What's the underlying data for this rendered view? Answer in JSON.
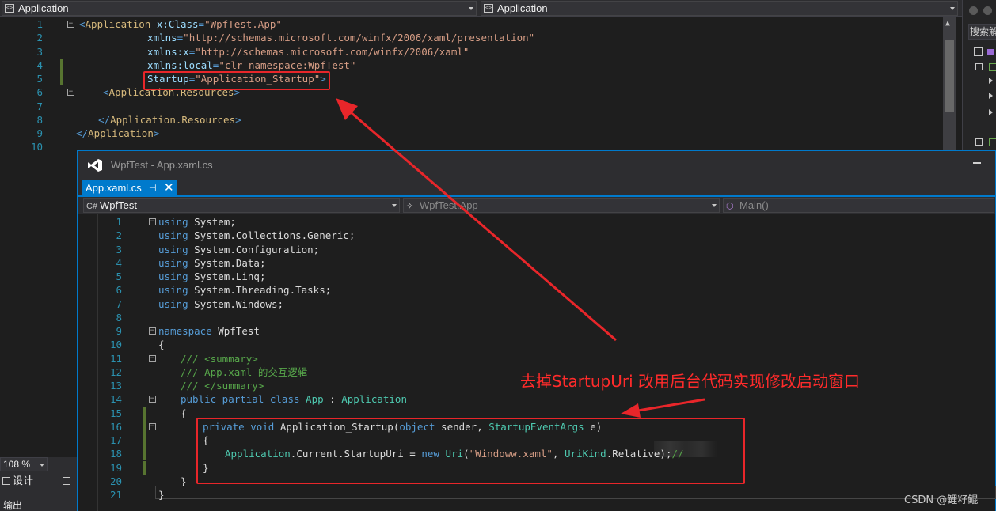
{
  "top_nav": {
    "left_scope": "Application",
    "right_scope": "Application"
  },
  "side_panel": {
    "search_placeholder": "搜索解"
  },
  "xaml_editor": {
    "lines": [
      {
        "n": "1",
        "tokens": [
          [
            "t-tag",
            "<"
          ],
          [
            "t-el",
            "Application"
          ],
          [
            "t-plain",
            " "
          ],
          [
            "t-attr",
            "x:Class"
          ],
          [
            "t-tag",
            "="
          ],
          [
            "t-str",
            "\"WpfTest.App\""
          ]
        ]
      },
      {
        "n": "2",
        "tokens": [
          [
            "t-attr",
            "xmlns"
          ],
          [
            "t-tag",
            "="
          ],
          [
            "t-str",
            "\"http://schemas.microsoft.com/winfx/2006/xaml/presentation\""
          ]
        ]
      },
      {
        "n": "3",
        "tokens": [
          [
            "t-attr",
            "xmlns:x"
          ],
          [
            "t-tag",
            "="
          ],
          [
            "t-str",
            "\"http://schemas.microsoft.com/winfx/2006/xaml\""
          ]
        ]
      },
      {
        "n": "4",
        "tokens": [
          [
            "t-attr",
            "xmlns:local"
          ],
          [
            "t-tag",
            "="
          ],
          [
            "t-str",
            "\"clr-namespace:WpfTest\""
          ]
        ]
      },
      {
        "n": "5",
        "tokens": [
          [
            "t-attr",
            "Startup"
          ],
          [
            "t-tag",
            "="
          ],
          [
            "t-str",
            "\"Application_Startup\""
          ],
          [
            "t-tag",
            ">"
          ]
        ]
      },
      {
        "n": "6",
        "tokens": [
          [
            "t-tag",
            "<"
          ],
          [
            "t-el",
            "Application.Resources"
          ],
          [
            "t-tag",
            ">"
          ]
        ]
      },
      {
        "n": "7",
        "tokens": []
      },
      {
        "n": "8",
        "tokens": [
          [
            "t-tag",
            "</"
          ],
          [
            "t-el",
            "Application.Resources"
          ],
          [
            "t-tag",
            ">"
          ]
        ]
      },
      {
        "n": "9",
        "tokens": [
          [
            "t-tag",
            "</"
          ],
          [
            "t-el",
            "Application"
          ],
          [
            "t-tag",
            ">"
          ]
        ]
      },
      {
        "n": "10",
        "tokens": []
      }
    ]
  },
  "status": {
    "zoom": "108 %",
    "design_tab": "设计",
    "output_label": "输出"
  },
  "window": {
    "title": "WpfTest - App.xaml.cs",
    "tab_label": "App.xaml.cs",
    "pin_glyph": "⊣",
    "close_glyph": "✕"
  },
  "nav2": {
    "project": "WpfTest",
    "class": "WpfTest.App",
    "member": "Main()"
  },
  "cs_editor": {
    "lines": [
      {
        "n": "1",
        "tokens": [
          [
            "t-kw",
            "using"
          ],
          [
            "t-plain",
            " System;"
          ]
        ]
      },
      {
        "n": "2",
        "tokens": [
          [
            "t-kw",
            "using"
          ],
          [
            "t-plain",
            " System.Collections.Generic;"
          ]
        ]
      },
      {
        "n": "3",
        "tokens": [
          [
            "t-kw",
            "using"
          ],
          [
            "t-plain",
            " System.Configuration;"
          ]
        ]
      },
      {
        "n": "4",
        "tokens": [
          [
            "t-kw",
            "using"
          ],
          [
            "t-plain",
            " System.Data;"
          ]
        ]
      },
      {
        "n": "5",
        "tokens": [
          [
            "t-kw",
            "using"
          ],
          [
            "t-plain",
            " System.Linq;"
          ]
        ]
      },
      {
        "n": "6",
        "tokens": [
          [
            "t-kw",
            "using"
          ],
          [
            "t-plain",
            " System.Threading.Tasks;"
          ]
        ]
      },
      {
        "n": "7",
        "tokens": [
          [
            "t-kw",
            "using"
          ],
          [
            "t-plain",
            " System.Windows;"
          ]
        ]
      },
      {
        "n": "8",
        "tokens": []
      },
      {
        "n": "9",
        "tokens": [
          [
            "t-kw",
            "namespace"
          ],
          [
            "t-plain",
            " WpfTest"
          ]
        ]
      },
      {
        "n": "10",
        "tokens": [
          [
            "t-plain",
            "{"
          ]
        ]
      },
      {
        "n": "11",
        "tokens": [
          [
            "t-com",
            "/// <summary>"
          ]
        ]
      },
      {
        "n": "12",
        "tokens": [
          [
            "t-com",
            "/// App.xaml 的交互逻辑"
          ]
        ]
      },
      {
        "n": "13",
        "tokens": [
          [
            "t-com",
            "/// </summary>"
          ]
        ]
      },
      {
        "n": "14",
        "tokens": [
          [
            "t-kw",
            "public partial class"
          ],
          [
            "t-plain",
            " "
          ],
          [
            "t-type",
            "App"
          ],
          [
            "t-plain",
            " : "
          ],
          [
            "t-type",
            "Application"
          ]
        ]
      },
      {
        "n": "15",
        "tokens": [
          [
            "t-plain",
            "{"
          ]
        ]
      },
      {
        "n": "16",
        "tokens": [
          [
            "t-kw",
            "private void"
          ],
          [
            "t-plain",
            " Application_Startup("
          ],
          [
            "t-kw",
            "object"
          ],
          [
            "t-plain",
            " sender, "
          ],
          [
            "t-type",
            "StartupEventArgs"
          ],
          [
            "t-plain",
            " e)"
          ]
        ]
      },
      {
        "n": "17",
        "tokens": [
          [
            "t-plain",
            "{"
          ]
        ]
      },
      {
        "n": "18",
        "tokens": [
          [
            "t-type",
            "Application"
          ],
          [
            "t-plain",
            ".Current.StartupUri = "
          ],
          [
            "t-kw",
            "new"
          ],
          [
            "t-plain",
            " "
          ],
          [
            "t-type",
            "Uri"
          ],
          [
            "t-plain",
            "("
          ],
          [
            "t-str",
            "\"Windoww.xaml\""
          ],
          [
            "t-plain",
            ", "
          ],
          [
            "t-type",
            "UriKind"
          ],
          [
            "t-plain",
            ".Relative);"
          ],
          [
            "t-com",
            "//"
          ]
        ]
      },
      {
        "n": "19",
        "tokens": [
          [
            "t-plain",
            "}"
          ]
        ]
      },
      {
        "n": "20",
        "tokens": [
          [
            "t-plain",
            "}"
          ]
        ]
      },
      {
        "n": "21",
        "tokens": [
          [
            "t-plain",
            "}"
          ]
        ]
      }
    ]
  },
  "annotation": {
    "text": "去掉StartupUri 改用后台代码实现修改启动窗口"
  },
  "watermark": "CSDN @鲤籽鲲",
  "colors": {
    "accent": "#007acc",
    "annotation_red": "#e8262a"
  }
}
